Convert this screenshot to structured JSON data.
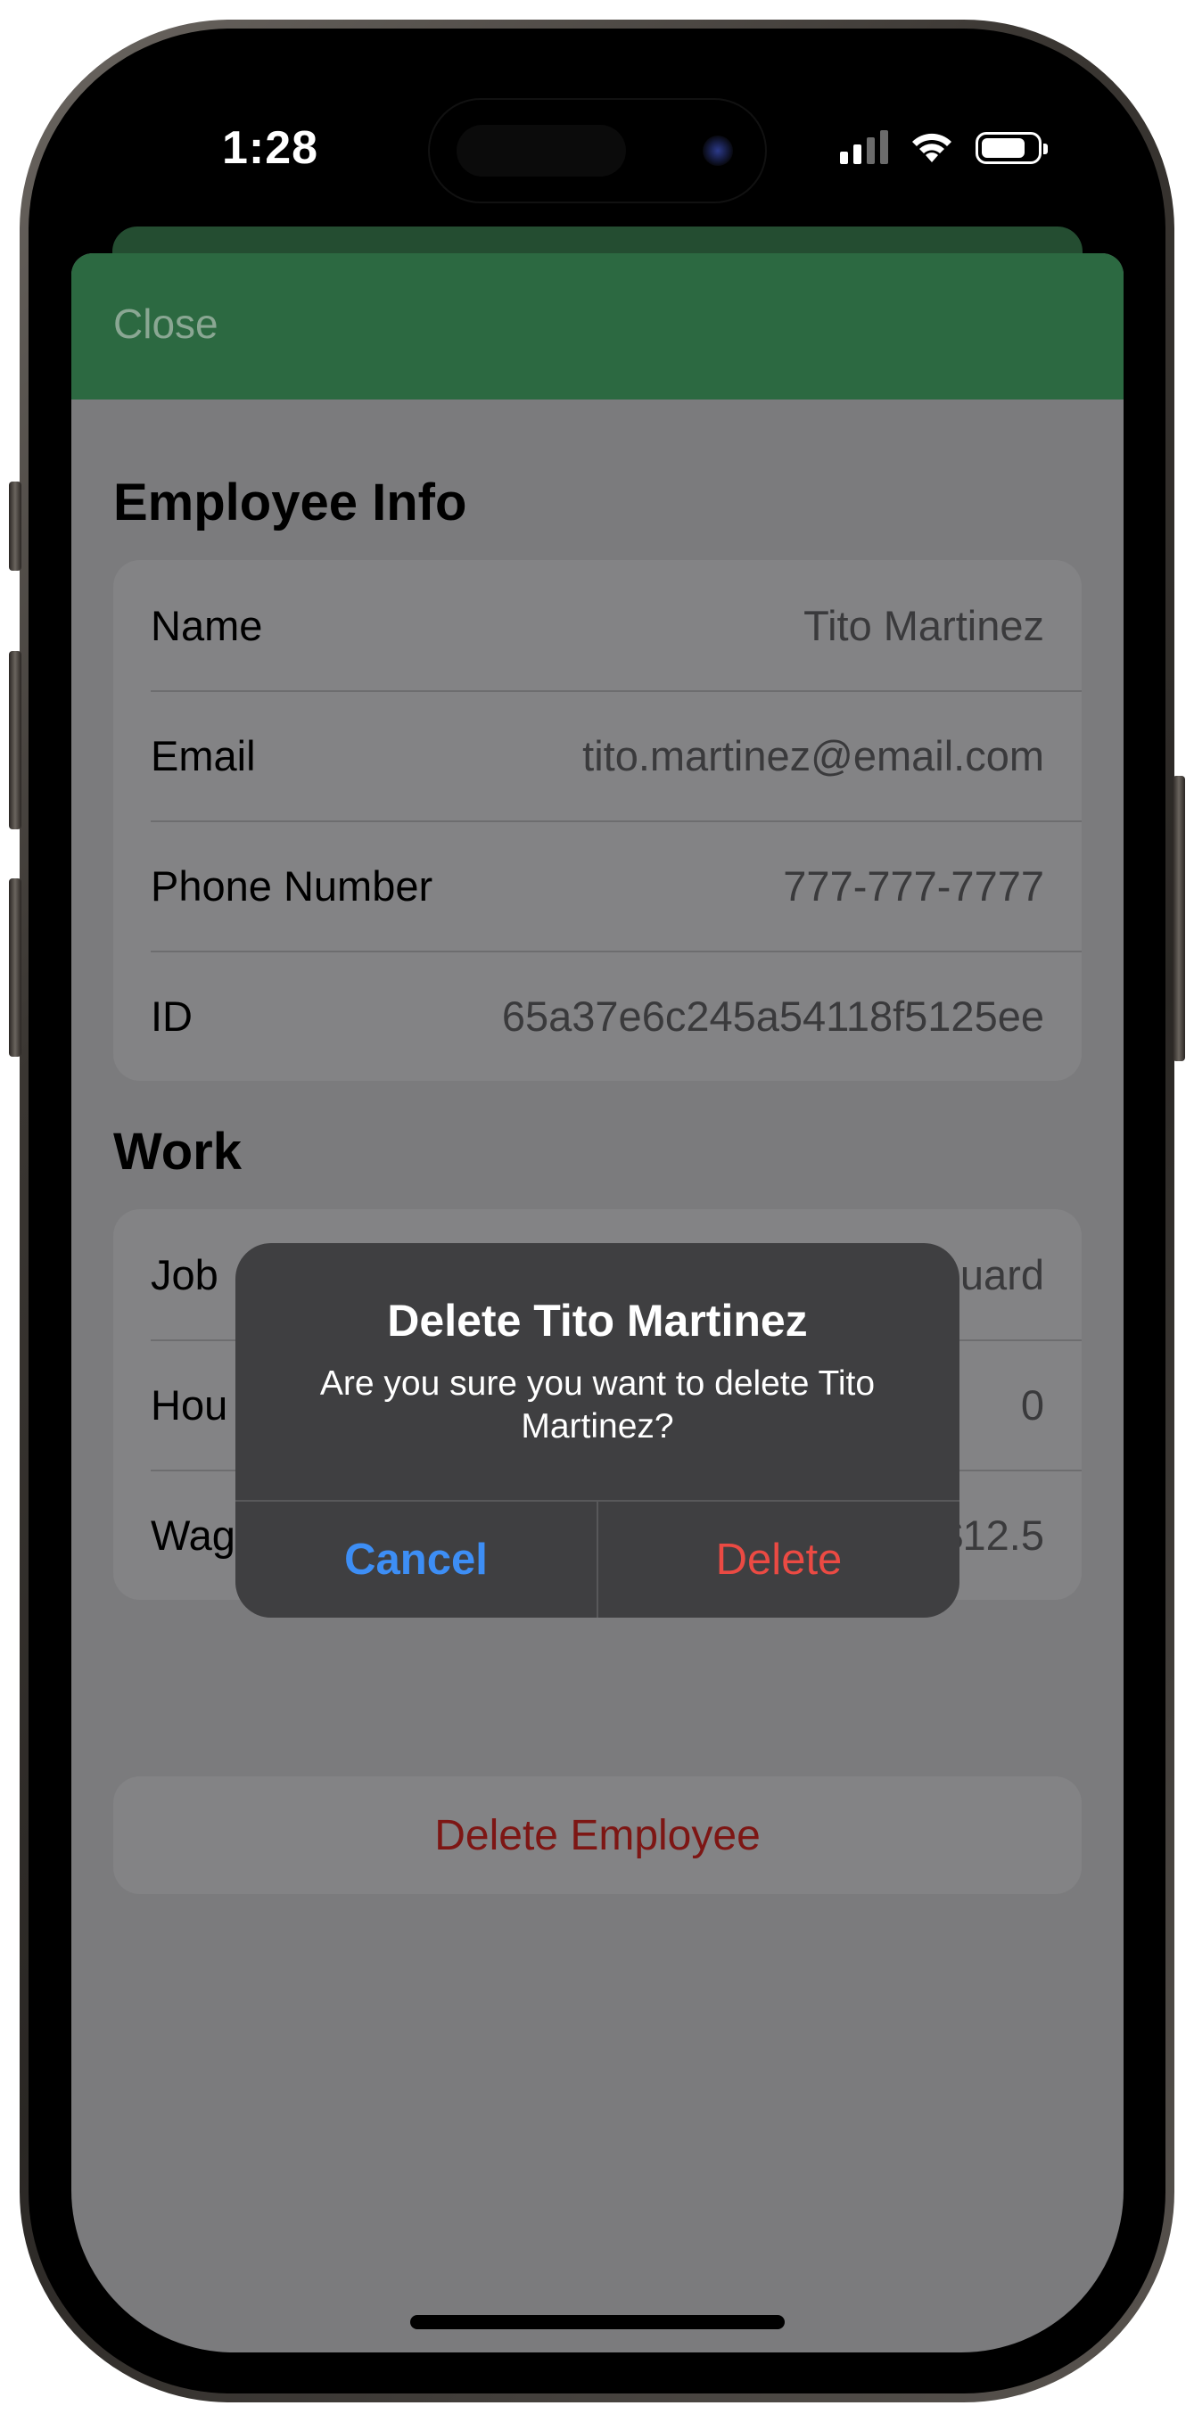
{
  "status_bar": {
    "time": "1:28",
    "signal_icon": "cellular-signal-icon",
    "wifi_icon": "wifi-icon",
    "battery_icon": "battery-icon",
    "battery_level": 0.8
  },
  "navbar": {
    "close_label": "Close",
    "color": "#2c6941"
  },
  "employee_info": {
    "title": "Employee Info",
    "rows": [
      {
        "label": "Name",
        "value": "Tito Martinez"
      },
      {
        "label": "Email",
        "value": "tito.martinez@email.com"
      },
      {
        "label": "Phone Number",
        "value": "777-777-7777"
      },
      {
        "label": "ID",
        "value": "65a37e6c245a54118f5125ee"
      }
    ]
  },
  "work_info": {
    "title_visible": "Work",
    "rows": [
      {
        "label_visible": "Job",
        "value_visible": "uard"
      },
      {
        "label_visible": "Hou",
        "value": "0"
      },
      {
        "label": "Wage",
        "value": "$12.5"
      }
    ]
  },
  "delete_employee_label": "Delete Employee",
  "alert": {
    "title": "Delete Tito Martinez",
    "message": "Are you sure you want to delete Tito Martinez?",
    "cancel_label": "Cancel",
    "delete_label": "Delete",
    "cancel_color": "#3d8ef5",
    "delete_color": "#eb4a43"
  }
}
